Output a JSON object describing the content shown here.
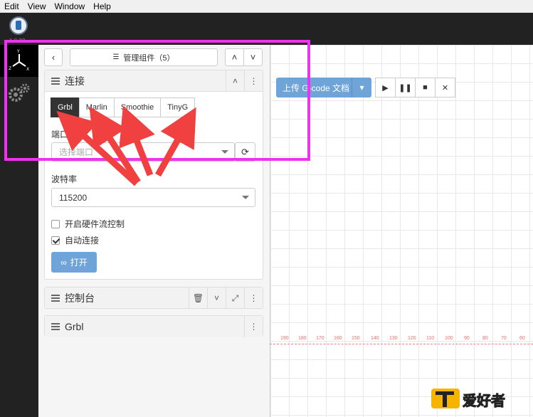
{
  "menu": [
    "Edit",
    "View",
    "Window",
    "Help"
  ],
  "version": "1.0.22",
  "widget_manager": {
    "label": "管理组件（5）"
  },
  "connection": {
    "title": "连接",
    "firmware_tabs": [
      "Grbl",
      "Marlin",
      "Smoothie",
      "TinyG"
    ],
    "port_label": "端口",
    "port_placeholder": "选择端口",
    "baud_label": "波特率",
    "baud_value": "115200",
    "flow_control_label": "开启硬件流控制",
    "auto_connect_label": "自动连接",
    "open_label": "打开"
  },
  "console": {
    "title": "控制台"
  },
  "grbl": {
    "title": "Grbl"
  },
  "toolbar": {
    "upload_label": "上传 G-code 文档"
  },
  "ruler_ticks": [
    "190",
    "180",
    "170",
    "160",
    "150",
    "140",
    "130",
    "120",
    "110",
    "100",
    "90",
    "80",
    "70",
    "60"
  ],
  "watermark": {
    "text": "爱好者"
  },
  "colors": {
    "highlight": "#ee33ee",
    "arrow": "#f04040",
    "button_blue": "#6ea4d8"
  }
}
